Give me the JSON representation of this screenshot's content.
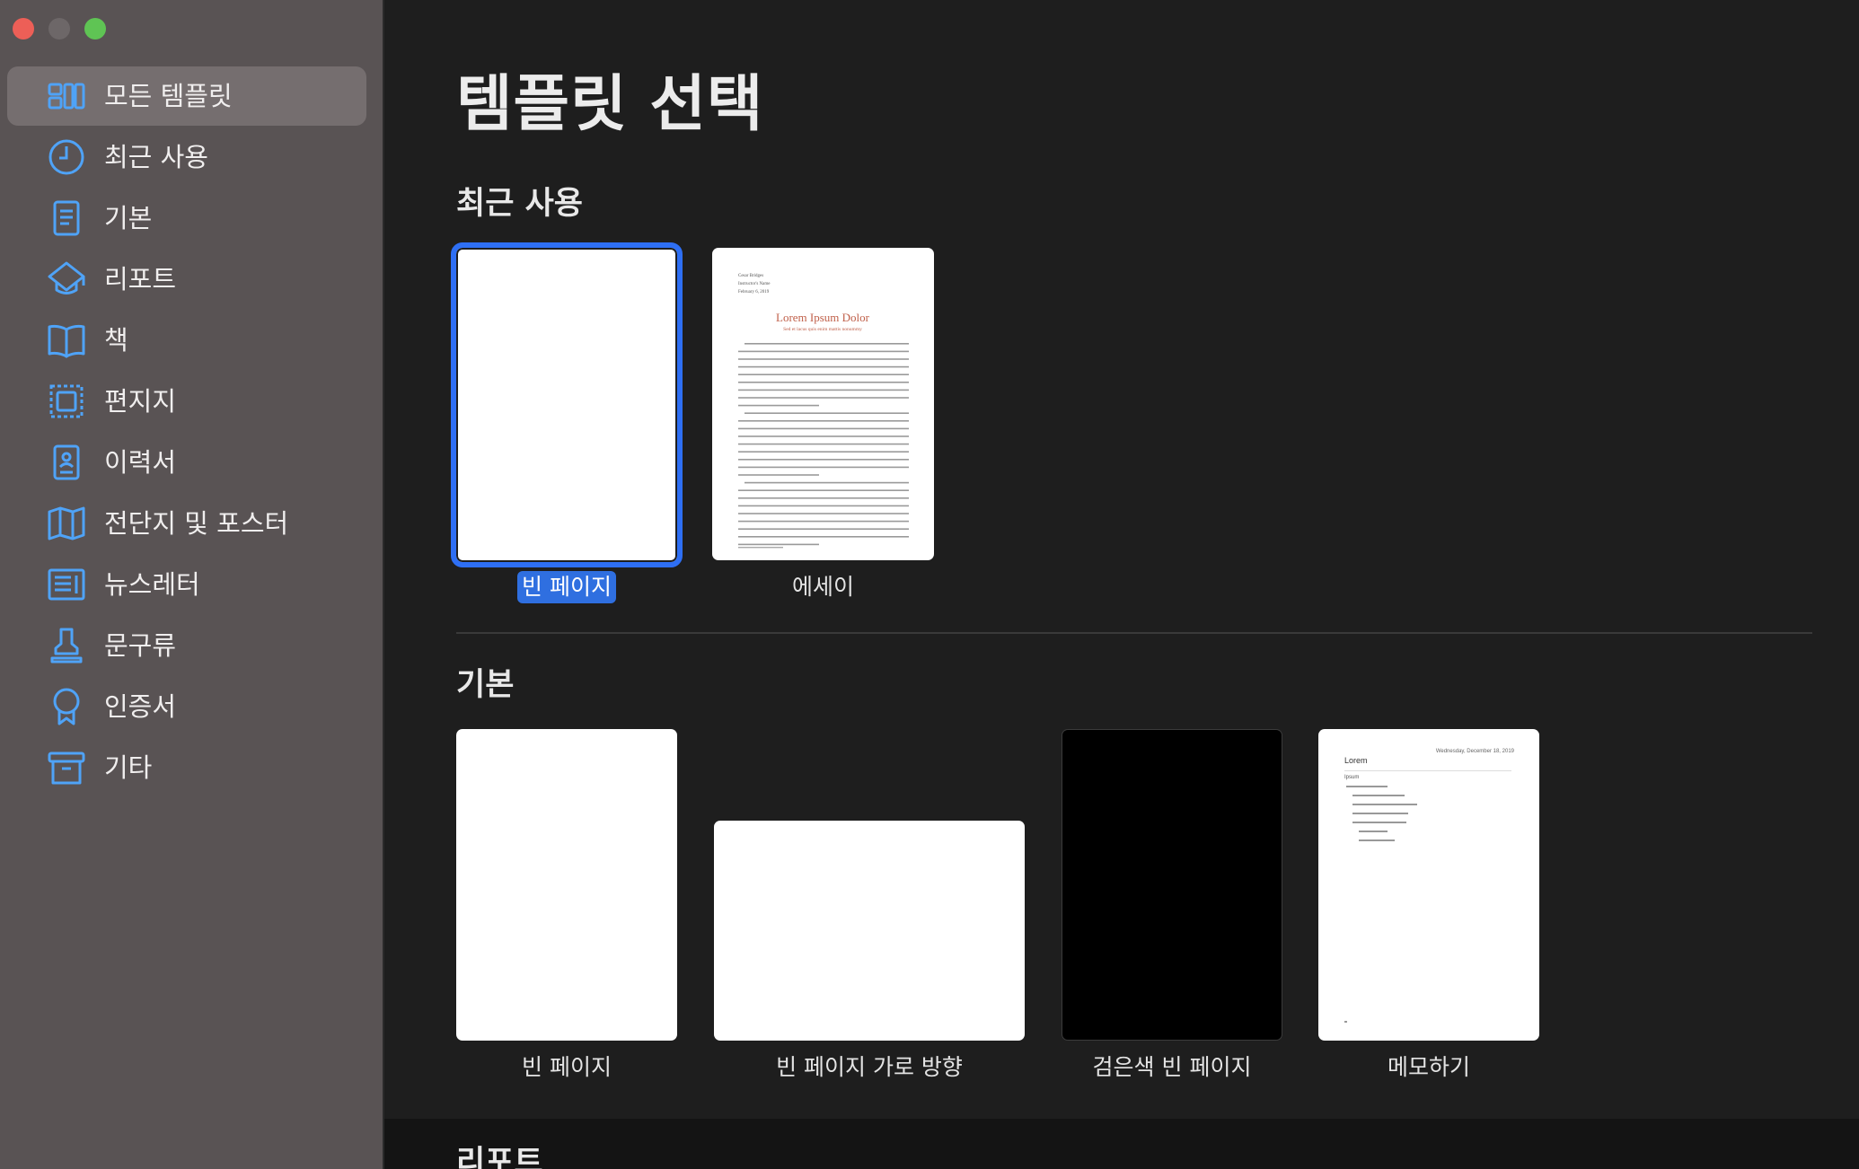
{
  "window_controls": {
    "close": "close",
    "minimize": "minimize",
    "zoom": "zoom"
  },
  "sidebar": {
    "items": [
      {
        "label": "모든 템플릿",
        "icon": "all-templates-icon",
        "selected": true
      },
      {
        "label": "최근 사용",
        "icon": "clock-icon",
        "selected": false
      },
      {
        "label": "기본",
        "icon": "document-icon",
        "selected": false
      },
      {
        "label": "리포트",
        "icon": "graduation-cap-icon",
        "selected": false
      },
      {
        "label": "책",
        "icon": "open-book-icon",
        "selected": false
      },
      {
        "label": "편지지",
        "icon": "stamp-frame-icon",
        "selected": false
      },
      {
        "label": "이력서",
        "icon": "resume-icon",
        "selected": false
      },
      {
        "label": "전단지 및 포스터",
        "icon": "map-icon",
        "selected": false
      },
      {
        "label": "뉴스레터",
        "icon": "newsletter-icon",
        "selected": false
      },
      {
        "label": "문구류",
        "icon": "rubber-stamp-icon",
        "selected": false
      },
      {
        "label": "인증서",
        "icon": "ribbon-icon",
        "selected": false
      },
      {
        "label": "기타",
        "icon": "archive-box-icon",
        "selected": false
      }
    ]
  },
  "main": {
    "title": "템플릿 선택",
    "sections": [
      {
        "heading": "최근 사용",
        "templates": [
          {
            "label": "빈 페이지",
            "selected": true
          },
          {
            "label": "에세이",
            "selected": false
          }
        ]
      },
      {
        "heading": "기본",
        "templates": [
          {
            "label": "빈 페이지"
          },
          {
            "label": "빈 페이지 가로 방향"
          },
          {
            "label": "검은색 빈 페이지"
          },
          {
            "label": "메모하기"
          }
        ]
      },
      {
        "heading": "리포트"
      }
    ],
    "essay_preview": {
      "author_lines": [
        "Cesar Bridges",
        "Instructor's Name",
        "February 6, 2019"
      ],
      "title": "Lorem Ipsum Dolor",
      "subtitle": "Sed et lacus quis enim mattis nonummy"
    },
    "memo_preview": {
      "title": "Lorem",
      "date": "Wednesday, December 18, 2019",
      "subtitle": "Ipsum"
    }
  },
  "colors": {
    "accent": "#2e6ff4",
    "sidebar_bg": "#595354",
    "main_bg": "#1e1e1e",
    "icon": "#4fa3f7",
    "essay_title": "#c0604a"
  }
}
